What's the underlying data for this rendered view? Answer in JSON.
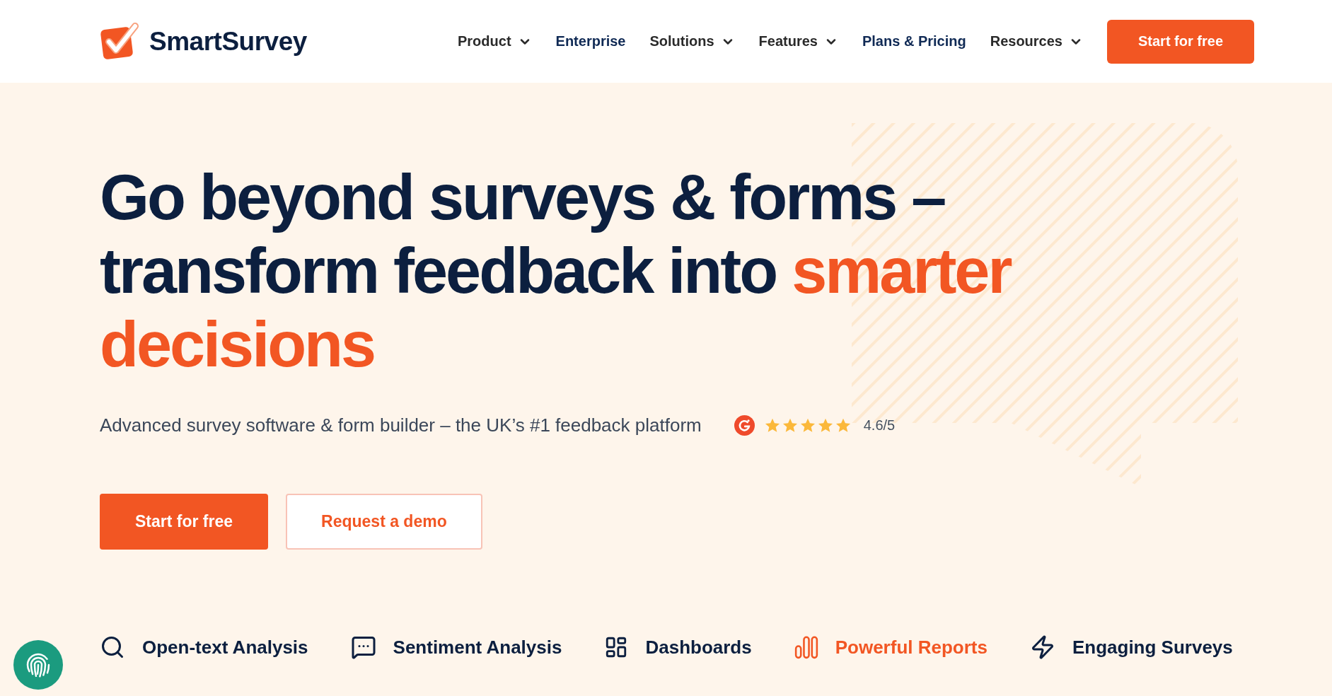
{
  "header": {
    "brand": "SmartSurvey",
    "nav": [
      {
        "label": "Product",
        "kind": "dropdown"
      },
      {
        "label": "Enterprise",
        "kind": "link"
      },
      {
        "label": "Solutions",
        "kind": "dropdown"
      },
      {
        "label": "Features",
        "kind": "dropdown"
      },
      {
        "label": "Plans & Pricing",
        "kind": "link"
      },
      {
        "label": "Resources",
        "kind": "dropdown"
      }
    ],
    "cta": "Start for free"
  },
  "hero": {
    "heading": "Go beyond surveys & forms – transform feedback into",
    "heading_highlight": "smarter decisions",
    "subtitle": "Advanced survey software & form builder – the UK’s #1 feedback platform",
    "rating": {
      "stars": 5,
      "score": "4.6/5"
    },
    "buttons": [
      {
        "label": "Start for free",
        "kind": "primary"
      },
      {
        "label": "Request a demo",
        "kind": "secondary"
      }
    ]
  },
  "features": [
    {
      "label": "Open-text Analysis",
      "selected": false
    },
    {
      "label": "Sentiment Analysis",
      "selected": false
    },
    {
      "label": "Dashboards",
      "selected": false
    },
    {
      "label": "Powerful Reports",
      "selected": true
    },
    {
      "label": "Engaging Surveys",
      "selected": false
    }
  ]
}
